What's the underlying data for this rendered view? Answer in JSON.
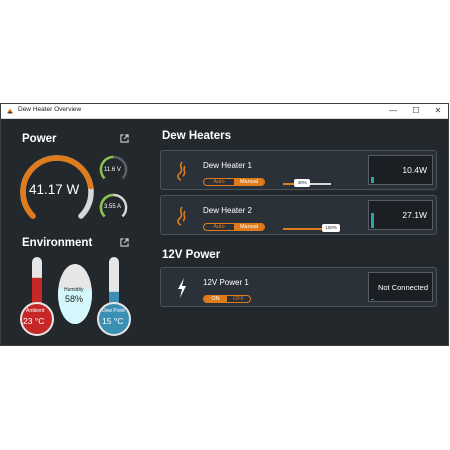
{
  "window": {
    "title": "Dew Heater Overview",
    "controls": {
      "minimize": "—",
      "maximize": "☐",
      "close": "✕"
    }
  },
  "colors": {
    "accent": "#e07b1b",
    "green": "#8bc34a",
    "red": "#c62828",
    "cyan": "#d4f7fb",
    "blue": "#3b8fb3",
    "chart_teal": "#2fa3a3"
  },
  "power": {
    "title": "Power",
    "icon": "external-link-icon",
    "watts": "41.17 W",
    "watts_fraction": 0.8,
    "voltage": "11.6 V",
    "voltage_fraction": 0.5,
    "current": "3.55 A",
    "current_fraction": 0.5
  },
  "environment": {
    "title": "Environment",
    "icon": "external-link-icon",
    "ambient": {
      "label": "Ambient",
      "value": "23 °C",
      "level": 0.7
    },
    "humidity": {
      "label": "Humidity",
      "value": "58%",
      "level": 0.58
    },
    "dew_point": {
      "label": "Dew Point",
      "value": "15 °C",
      "level": 0.45
    }
  },
  "dew_heaters": {
    "title": "Dew Heaters",
    "items": [
      {
        "name": "Dew Heater 1",
        "icon": "flame-icon",
        "mode_auto": "Auto",
        "mode_manual": "Manual",
        "selected": "Manual",
        "slider_label": "40%",
        "slider_value": 0.4,
        "reading": "10.4W",
        "chart_level": 0.2
      },
      {
        "name": "Dew Heater 2",
        "icon": "flame-icon",
        "mode_auto": "Auto",
        "mode_manual": "Manual",
        "selected": "Manual",
        "slider_label": "100%",
        "slider_value": 1.0,
        "reading": "27.1W",
        "chart_level": 0.55
      }
    ]
  },
  "power12v": {
    "title": "12V Power",
    "items": [
      {
        "name": "12V Power 1",
        "icon": "lightning-icon",
        "on_label": "ON",
        "off_label": "OFF",
        "selected": "ON",
        "reading": "Not Connected"
      }
    ]
  }
}
